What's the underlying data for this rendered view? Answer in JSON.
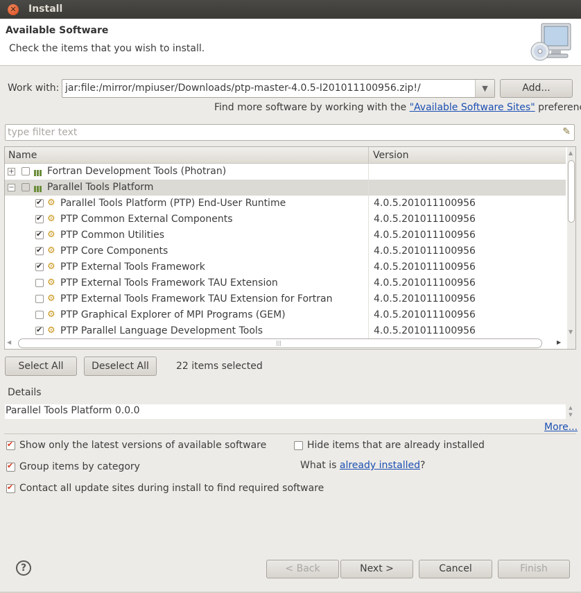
{
  "window": {
    "title": "Install"
  },
  "header": {
    "title": "Available Software",
    "subtitle": "Check the items that you wish to install."
  },
  "work_with": {
    "label": "Work with:",
    "value": "jar:file:/mirror/mpiuser/Downloads/ptp-master-4.0.5-I201011100956.zip!/",
    "add_label": "Add...",
    "find_more_prefix": "Find more software by working with the ",
    "find_more_link": "\"Available Software Sites\"",
    "find_more_suffix": " preferences."
  },
  "filter": {
    "placeholder": "type filter text"
  },
  "table": {
    "columns": [
      "Name",
      "Version"
    ],
    "rows": [
      {
        "type": "category",
        "expanded": false,
        "checked": false,
        "name": "Fortran Development Tools (Photran)",
        "version": ""
      },
      {
        "type": "category",
        "expanded": true,
        "checked": false,
        "selected": true,
        "name": "Parallel Tools Platform",
        "version": ""
      },
      {
        "type": "item",
        "checked": true,
        "name": "Parallel Tools Platform (PTP) End-User Runtime",
        "version": "4.0.5.201011100956"
      },
      {
        "type": "item",
        "checked": true,
        "name": "PTP Common External Components",
        "version": "4.0.5.201011100956"
      },
      {
        "type": "item",
        "checked": true,
        "name": "PTP Common Utilities",
        "version": "4.0.5.201011100956"
      },
      {
        "type": "item",
        "checked": true,
        "name": "PTP Core Components",
        "version": "4.0.5.201011100956"
      },
      {
        "type": "item",
        "checked": true,
        "name": "PTP External Tools Framework",
        "version": "4.0.5.201011100956"
      },
      {
        "type": "item",
        "checked": false,
        "name": "PTP External Tools Framework TAU Extension",
        "version": "4.0.5.201011100956"
      },
      {
        "type": "item",
        "checked": false,
        "name": "PTP External Tools Framework TAU Extension for Fortran",
        "version": "4.0.5.201011100956"
      },
      {
        "type": "item",
        "checked": false,
        "name": "PTP Graphical Explorer of MPI Programs (GEM)",
        "version": "4.0.5.201011100956"
      },
      {
        "type": "item",
        "checked": true,
        "name": "PTP Parallel Language Development Tools",
        "version": "4.0.5.201011100956"
      }
    ]
  },
  "selection": {
    "select_all": "Select All",
    "deselect_all": "Deselect All",
    "count_text": "22 items selected"
  },
  "details": {
    "label": "Details",
    "text": "Parallel Tools Platform 0.0.0",
    "more": "More..."
  },
  "options": {
    "latest_only": {
      "label": "Show only the latest versions of available software",
      "checked": true
    },
    "group_by_category": {
      "label": "Group items by category",
      "checked": true
    },
    "contact_all_sites": {
      "label": "Contact all update sites during install to find required software",
      "checked": true
    },
    "hide_installed": {
      "label": "Hide items that are already installed",
      "checked": false
    },
    "what_is_prefix": "What is ",
    "what_is_link": "already installed",
    "what_is_suffix": "?"
  },
  "footer": {
    "help": "?",
    "back": "< Back",
    "next": "Next >",
    "cancel": "Cancel",
    "finish": "Finish"
  },
  "colors": {
    "background": "#edebe7",
    "link": "#1b4fb3",
    "checkbox_check": "#d8381c",
    "titlebar": "#3c3b37"
  }
}
